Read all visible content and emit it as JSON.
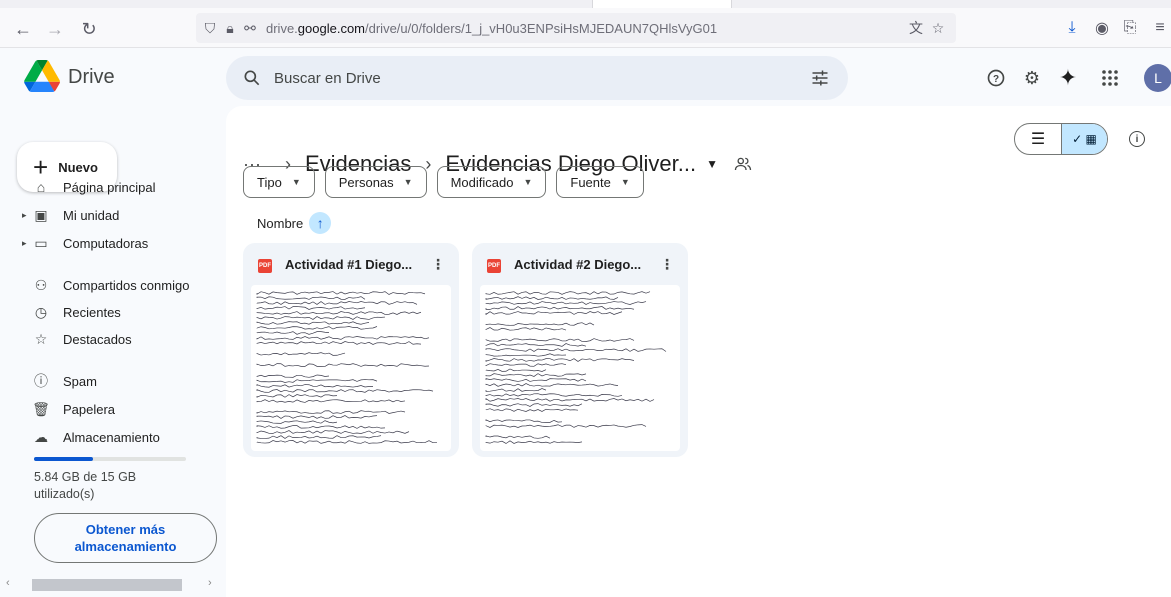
{
  "browser": {
    "url_prefix": "drive.",
    "url_domain": "google.com",
    "url_path": "/drive/u/0/folders/1_j_vH0u3ENPsiHsMJEDAUN7QHlsVyG01"
  },
  "header": {
    "app_name": "Drive",
    "search_placeholder": "Buscar en Drive",
    "avatar_letter": "L"
  },
  "sidebar": {
    "new_label": "Nuevo",
    "items": [
      {
        "label": "Página principal",
        "icon": "home-icon"
      },
      {
        "label": "Mi unidad",
        "icon": "my-drive-icon"
      },
      {
        "label": "Computadoras",
        "icon": "computer-icon"
      },
      {
        "label": "Compartidos conmigo",
        "icon": "shared-icon"
      },
      {
        "label": "Recientes",
        "icon": "clock-icon"
      },
      {
        "label": "Destacados",
        "icon": "star-icon"
      },
      {
        "label": "Spam",
        "icon": "spam-icon"
      },
      {
        "label": "Papelera",
        "icon": "trash-icon"
      },
      {
        "label": "Almacenamiento",
        "icon": "cloud-icon"
      }
    ],
    "storage_text": "5.84 GB de 15 GB utilizado(s)",
    "storage_fraction": 0.389,
    "more_storage_label": "Obtener más almacenamiento"
  },
  "main": {
    "breadcrumb_parent": "Evidencias",
    "breadcrumb_current": "Evidencias Diego Oliver...",
    "filters": [
      "Tipo",
      "Personas",
      "Modificado",
      "Fuente"
    ],
    "sort_label": "Nombre",
    "files": [
      {
        "name": "Actividad #1 Diego...",
        "type_badge": "PDF"
      },
      {
        "name": "Actividad #2 Diego...",
        "type_badge": "PDF"
      }
    ]
  },
  "colors": {
    "accent": "#0b57d0",
    "selected_bg": "#c2e7ff",
    "pdf_red": "#ea4335"
  }
}
